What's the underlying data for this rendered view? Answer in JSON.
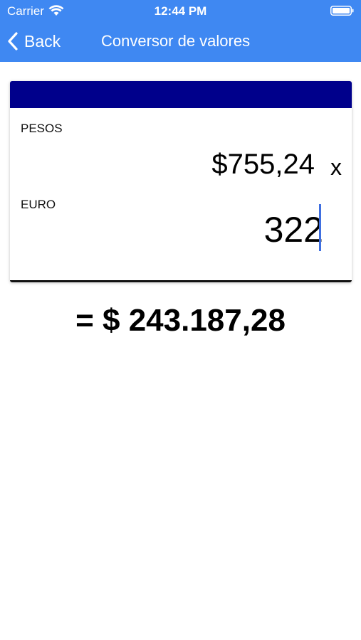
{
  "status_bar": {
    "carrier": "Carrier",
    "time": "12:44 PM"
  },
  "nav": {
    "back_label": "Back",
    "title": "Conversor de valores"
  },
  "converter": {
    "pesos_label": "PESOS",
    "pesos_value": "$755,24",
    "operator": "x",
    "euro_label": "EURO",
    "euro_value": "322"
  },
  "result": {
    "text": "= $ 243.187,28"
  },
  "colors": {
    "header": "#3f88f2",
    "card_top": "#00008b",
    "caret": "#3f6fe0"
  }
}
